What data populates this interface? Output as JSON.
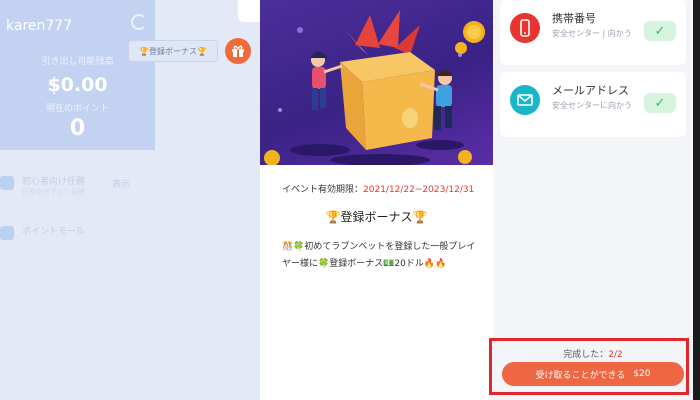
{
  "profile": {
    "username": "karen777",
    "balance_label": "引き出し可能残高",
    "balance_value": "$0.00",
    "points_label": "現在のポイント",
    "points_value": "0"
  },
  "side_menu": [
    {
      "title": "初心者向け任務",
      "sub": "任務を完了して報酬",
      "side": "表示"
    },
    {
      "title": "ポイントモール",
      "sub": "",
      "side": ""
    }
  ],
  "bonus_chip": {
    "label": "🏆登録ボーナス🏆"
  },
  "event": {
    "period_label": "イベント有効期限：",
    "period_dates": "2021/12/22~2023/12/31",
    "title": "🏆登録ボーナス🏆",
    "description": "🎊🍀初めてラブンベットを登録した一般プレイヤー様に🍀登録ボーナス💵20ドル🔥🔥"
  },
  "tasks": [
    {
      "title": "携帯番号",
      "sub": "安全センター | 向かう",
      "icon": "phone-icon",
      "color": "#e8352f"
    },
    {
      "title": "メールアドレス",
      "sub": "安全センターに向かう",
      "icon": "mail-icon",
      "color": "#19b6c9"
    }
  ],
  "completion": {
    "label": "完成した：",
    "count": "2/2",
    "claim_label": "受け取ることができる",
    "claim_amount": "$20"
  }
}
